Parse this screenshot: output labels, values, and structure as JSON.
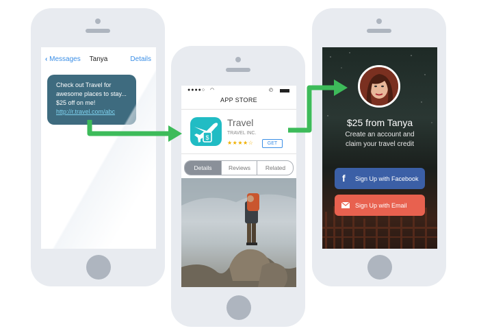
{
  "messages_screen": {
    "back_label": "Messages",
    "contact_name": "Tanya",
    "details_label": "Details",
    "message_lines": [
      "Check out Travel for",
      "awesome places to stay...",
      "$25 off on me!"
    ],
    "message_link": "http://r.travel.com/abc"
  },
  "app_store_screen": {
    "title": "APP STORE",
    "app_name": "Travel",
    "app_company": "TRAVEL INC.",
    "rating_stars": "★★★★☆",
    "rating": 4,
    "get_label": "GET",
    "tabs": [
      {
        "label": "Details",
        "active": true
      },
      {
        "label": "Reviews",
        "active": false
      },
      {
        "label": "Related",
        "active": false
      }
    ]
  },
  "landing_screen": {
    "headline": "$25 from Tanya",
    "subline_1": "Create an account and",
    "subline_2": "claim your travel credit",
    "facebook_button": "Sign Up with Facebook",
    "email_button": "Sign Up with Email"
  },
  "colors": {
    "arrow": "#3dbb5a",
    "app_icon": "#21bcc4",
    "bubble": "#3e6b7f",
    "facebook": "#3b5fa6",
    "email": "#e8614f"
  }
}
